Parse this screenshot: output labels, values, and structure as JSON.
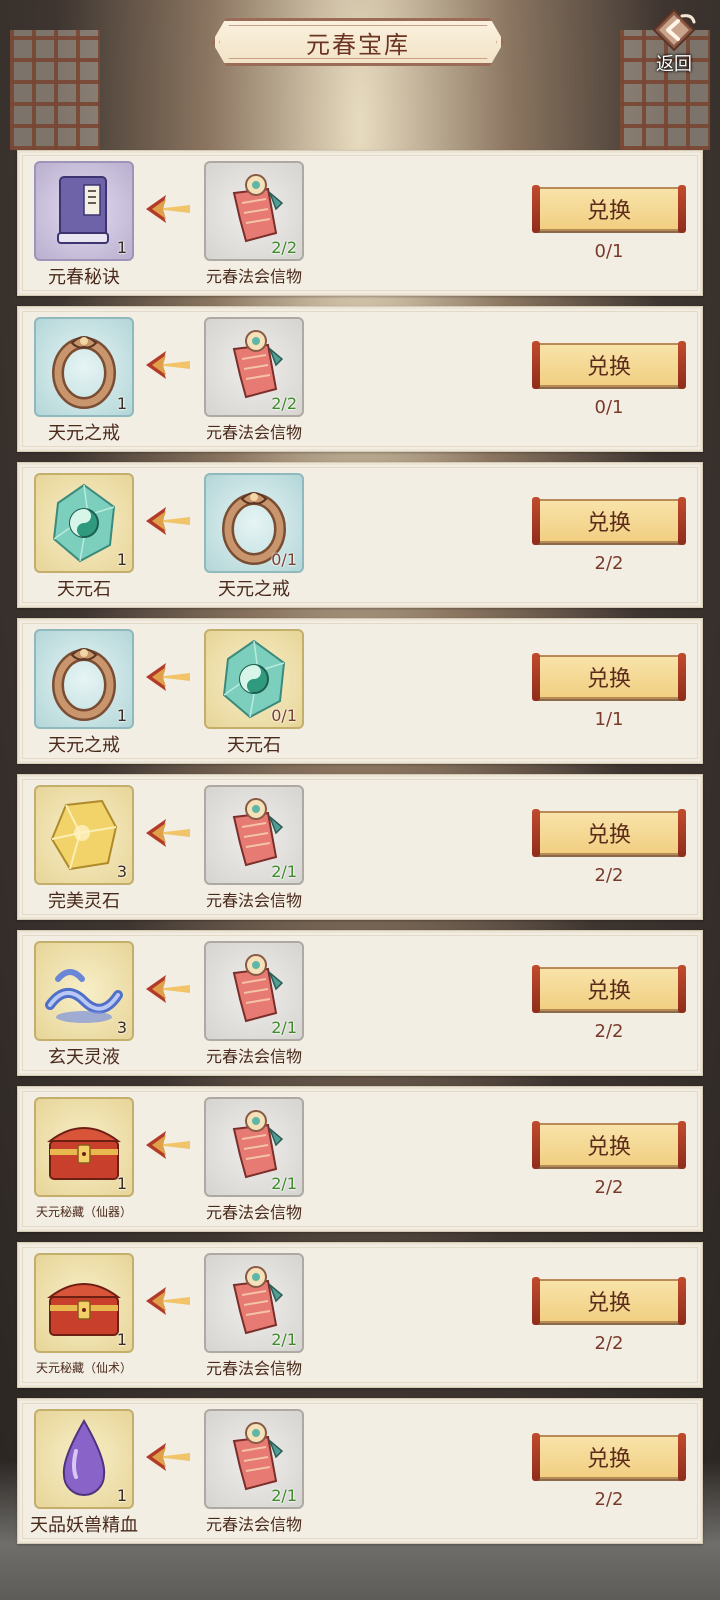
{
  "header": {
    "title": "元春宝库",
    "back_label": "返回"
  },
  "colors": {
    "accent": "#6b3423",
    "button_fill": "#f1cf82",
    "count_ok": "#3d8a2a"
  },
  "rows": [
    {
      "target": {
        "name": "元春秘诀",
        "icon": "secret-book-icon",
        "count": "1",
        "bg": "purple"
      },
      "source": {
        "name": "元春法会信物",
        "icon": "token-scroll-icon",
        "count": "2/2",
        "count_color": "green"
      },
      "button": "兑换",
      "limit": "0/1"
    },
    {
      "target": {
        "name": "天元之戒",
        "icon": "ring-icon",
        "count": "1",
        "bg": "blue"
      },
      "source": {
        "name": "元春法会信物",
        "icon": "token-scroll-icon",
        "count": "2/2",
        "count_color": "green"
      },
      "button": "兑换",
      "limit": "0/1"
    },
    {
      "target": {
        "name": "天元石",
        "icon": "jade-stone-icon",
        "count": "1",
        "bg": "gold"
      },
      "source": {
        "name": "天元之戒",
        "icon": "ring-icon",
        "count": "0/1",
        "count_color": "redish"
      },
      "button": "兑换",
      "limit": "2/2"
    },
    {
      "target": {
        "name": "天元之戒",
        "icon": "ring-icon",
        "count": "1",
        "bg": "blue"
      },
      "source": {
        "name": "天元石",
        "icon": "jade-stone-icon",
        "count": "0/1",
        "count_color": "redish"
      },
      "button": "兑换",
      "limit": "1/1"
    },
    {
      "target": {
        "name": "完美灵石",
        "icon": "gold-stone-icon",
        "count": "3",
        "bg": "gold"
      },
      "source": {
        "name": "元春法会信物",
        "icon": "token-scroll-icon",
        "count": "2/1",
        "count_color": "green"
      },
      "button": "兑换",
      "limit": "2/2"
    },
    {
      "target": {
        "name": "玄天灵液",
        "icon": "spirit-liquid-icon",
        "count": "3",
        "bg": "gold"
      },
      "source": {
        "name": "元春法会信物",
        "icon": "token-scroll-icon",
        "count": "2/1",
        "count_color": "green"
      },
      "button": "兑换",
      "limit": "2/2"
    },
    {
      "target": {
        "name": "天元秘藏（仙器）",
        "icon": "treasure-chest-icon",
        "count": "1",
        "bg": "gold"
      },
      "source": {
        "name": "元春法会信物",
        "icon": "token-scroll-icon",
        "count": "2/1",
        "count_color": "green"
      },
      "button": "兑换",
      "limit": "2/2"
    },
    {
      "target": {
        "name": "天元秘藏（仙术）",
        "icon": "treasure-chest-icon",
        "count": "1",
        "bg": "gold"
      },
      "source": {
        "name": "元春法会信物",
        "icon": "token-scroll-icon",
        "count": "2/1",
        "count_color": "green"
      },
      "button": "兑换",
      "limit": "2/2"
    },
    {
      "target": {
        "name": "天品妖兽精血",
        "icon": "beast-blood-icon",
        "count": "1",
        "bg": "gold"
      },
      "source": {
        "name": "元春法会信物",
        "icon": "token-scroll-icon",
        "count": "2/1",
        "count_color": "green"
      },
      "button": "兑换",
      "limit": "2/2"
    }
  ]
}
